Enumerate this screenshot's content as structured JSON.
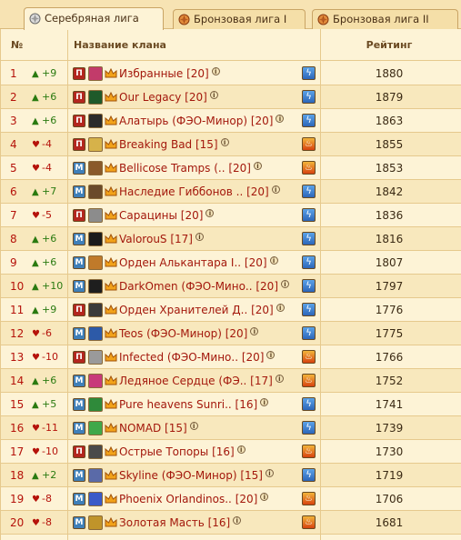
{
  "tabs": [
    {
      "label": "Серебряная лига",
      "icon": "silver-league-icon",
      "active": true
    },
    {
      "label": "Бронзовая лига I",
      "icon": "bronze-league-icon",
      "active": false
    },
    {
      "label": "Бронзовая лига II",
      "icon": "bronze-league-icon",
      "active": false
    }
  ],
  "table": {
    "col_num": "№",
    "col_name": "Название клана",
    "col_rating": "Рейтинг"
  },
  "rows": [
    {
      "rank": "1",
      "dir": "up",
      "delta": "+9",
      "badge": "П",
      "emblem": "#c23b6a",
      "name": "Избранные [20]",
      "element": "light",
      "rating": "1880"
    },
    {
      "rank": "2",
      "dir": "up",
      "delta": "+6",
      "badge": "П",
      "emblem": "#1f5a2a",
      "name": "Our Legacy [20]",
      "element": "light",
      "rating": "1879"
    },
    {
      "rank": "3",
      "dir": "up",
      "delta": "+6",
      "badge": "П",
      "emblem": "#2b2b2b",
      "name": "Алатырь (ФЭО-Минор) [20]",
      "element": "light",
      "rating": "1863"
    },
    {
      "rank": "4",
      "dir": "down",
      "delta": "-4",
      "badge": "П",
      "emblem": "#d6b24a",
      "name": "Breaking Bad [15]",
      "element": "fire",
      "rating": "1855"
    },
    {
      "rank": "5",
      "dir": "down",
      "delta": "-4",
      "badge": "М",
      "emblem": "#8a5a2a",
      "name": "Bellicose Tramps (.. [20]",
      "element": "fire",
      "rating": "1853"
    },
    {
      "rank": "6",
      "dir": "up",
      "delta": "+7",
      "badge": "М",
      "emblem": "#6a4a2a",
      "name": "Наследие Гиббонов .. [20]",
      "element": "light",
      "rating": "1842"
    },
    {
      "rank": "7",
      "dir": "down",
      "delta": "-5",
      "badge": "П",
      "emblem": "#8c8c8c",
      "name": "Сарацины [20]",
      "element": "light",
      "rating": "1836"
    },
    {
      "rank": "8",
      "dir": "up",
      "delta": "+6",
      "badge": "М",
      "emblem": "#1b1b1b",
      "name": "ValorouS [17]",
      "element": "light",
      "rating": "1816"
    },
    {
      "rank": "9",
      "dir": "up",
      "delta": "+6",
      "badge": "М",
      "emblem": "#c07a2a",
      "name": "Орден Алькантара I.. [20]",
      "element": "light",
      "rating": "1807"
    },
    {
      "rank": "10",
      "dir": "up",
      "delta": "+10",
      "badge": "М",
      "emblem": "#1e1e1e",
      "name": "DarkOmen (ФЭО-Мино.. [20]",
      "element": "light",
      "rating": "1797"
    },
    {
      "rank": "11",
      "dir": "up",
      "delta": "+9",
      "badge": "П",
      "emblem": "#3a3a3a",
      "name": "Орден Хранителей Д.. [20]",
      "element": "light",
      "rating": "1776"
    },
    {
      "rank": "12",
      "dir": "down",
      "delta": "-6",
      "badge": "М",
      "emblem": "#2d5aa8",
      "name": "Teos (ФЭО-Минор) [20]",
      "element": "light",
      "rating": "1775"
    },
    {
      "rank": "13",
      "dir": "down",
      "delta": "-10",
      "badge": "П",
      "emblem": "#9a9a9a",
      "name": "Infected (ФЭО-Мино.. [20]",
      "element": "fire",
      "rating": "1766"
    },
    {
      "rank": "14",
      "dir": "up",
      "delta": "+6",
      "badge": "М",
      "emblem": "#c83a7a",
      "name": "Ледяное Сердце (ФЭ.. [17]",
      "element": "fire",
      "rating": "1752"
    },
    {
      "rank": "15",
      "dir": "up",
      "delta": "+5",
      "badge": "М",
      "emblem": "#2f8a3a",
      "name": "Pure heavens Sunri.. [16]",
      "element": "light",
      "rating": "1741"
    },
    {
      "rank": "16",
      "dir": "down",
      "delta": "-11",
      "badge": "М",
      "emblem": "#3fa84a",
      "name": "NOMAD [15]",
      "element": "light",
      "rating": "1739"
    },
    {
      "rank": "17",
      "dir": "down",
      "delta": "-10",
      "badge": "П",
      "emblem": "#4a4a4a",
      "name": "Острые Топоры [16]",
      "element": "fire",
      "rating": "1730"
    },
    {
      "rank": "18",
      "dir": "up",
      "delta": "+2",
      "badge": "М",
      "emblem": "#5a6aa8",
      "name": "Skyline (ФЭО-Минор) [15]",
      "element": "light",
      "rating": "1719"
    },
    {
      "rank": "19",
      "dir": "down",
      "delta": "-8",
      "badge": "М",
      "emblem": "#3a5ac8",
      "name": "Phoenix Orlandinos.. [20]",
      "element": "fire",
      "rating": "1706"
    },
    {
      "rank": "20",
      "dir": "down",
      "delta": "-8",
      "badge": "М",
      "emblem": "#c0942a",
      "name": "Золотая Масть [16]",
      "element": "fire",
      "rating": "1681"
    }
  ]
}
